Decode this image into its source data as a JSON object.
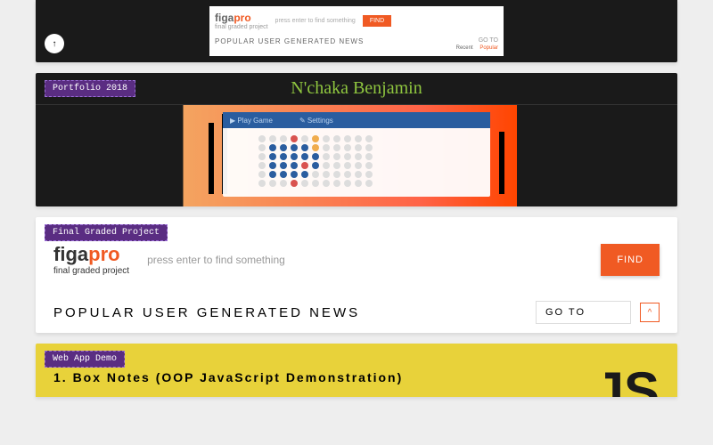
{
  "card1": {
    "logo": "figa",
    "logo_accent": "pro",
    "logo_sub": "final graded project",
    "placeholder": "press enter to find something",
    "find": "FIND",
    "popular": "POPULAR USER GENERATED NEWS",
    "goto": "GO TO",
    "link_recent": "Recent",
    "link_popular": "Popular"
  },
  "card2": {
    "label": "Portfolio 2018",
    "title": "N'chaka Benjamin",
    "tab1": "Play Game",
    "tab2": "Settings"
  },
  "card3": {
    "label": "Final Graded Project",
    "logo": "figa",
    "logo_accent": "pro",
    "logo_sub": "final graded project",
    "placeholder": "press enter to find something",
    "find": "FIND",
    "popular": "POPULAR USER GENERATED NEWS",
    "goto": "GO TO",
    "caret": "^"
  },
  "card4": {
    "label": "Web App Demo",
    "title": "1.   Box  Notes  (OOP  JavaScript  Demonstration)",
    "js": "JS"
  }
}
